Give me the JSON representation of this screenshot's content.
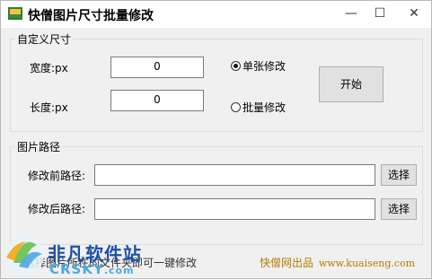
{
  "window": {
    "title": "快僧图片尺寸批量修改",
    "controls": {
      "minimize": "—",
      "maximize": "☐",
      "close": "✕"
    }
  },
  "size_group": {
    "legend": "自定义尺寸",
    "width_label": "宽度:px",
    "width_value": "0",
    "height_label": "长度:px",
    "height_value": "0",
    "mode_single": "单张修改",
    "mode_batch": "批量修改",
    "selected_mode": "single",
    "start_button": "开始"
  },
  "path_group": {
    "legend": "图片路径",
    "before_label": "修改前路径:",
    "before_value": "",
    "after_label": "修改后路径:",
    "after_value": "",
    "browse_label": "选择"
  },
  "footer": {
    "hint": "选择图片所在的文件夹即可一键修改",
    "brand": "快僧网出品",
    "url": "www.kuaiseng.com"
  },
  "watermark": {
    "cn": "非凡软件站",
    "en": "CRSKY",
    "suffix": ".com"
  },
  "colors": {
    "window_bg": "#f0f0f0",
    "footer_brand": "#b87a00",
    "watermark_blue": "#1b4fa8",
    "watermark_light": "#4fa9e0"
  }
}
